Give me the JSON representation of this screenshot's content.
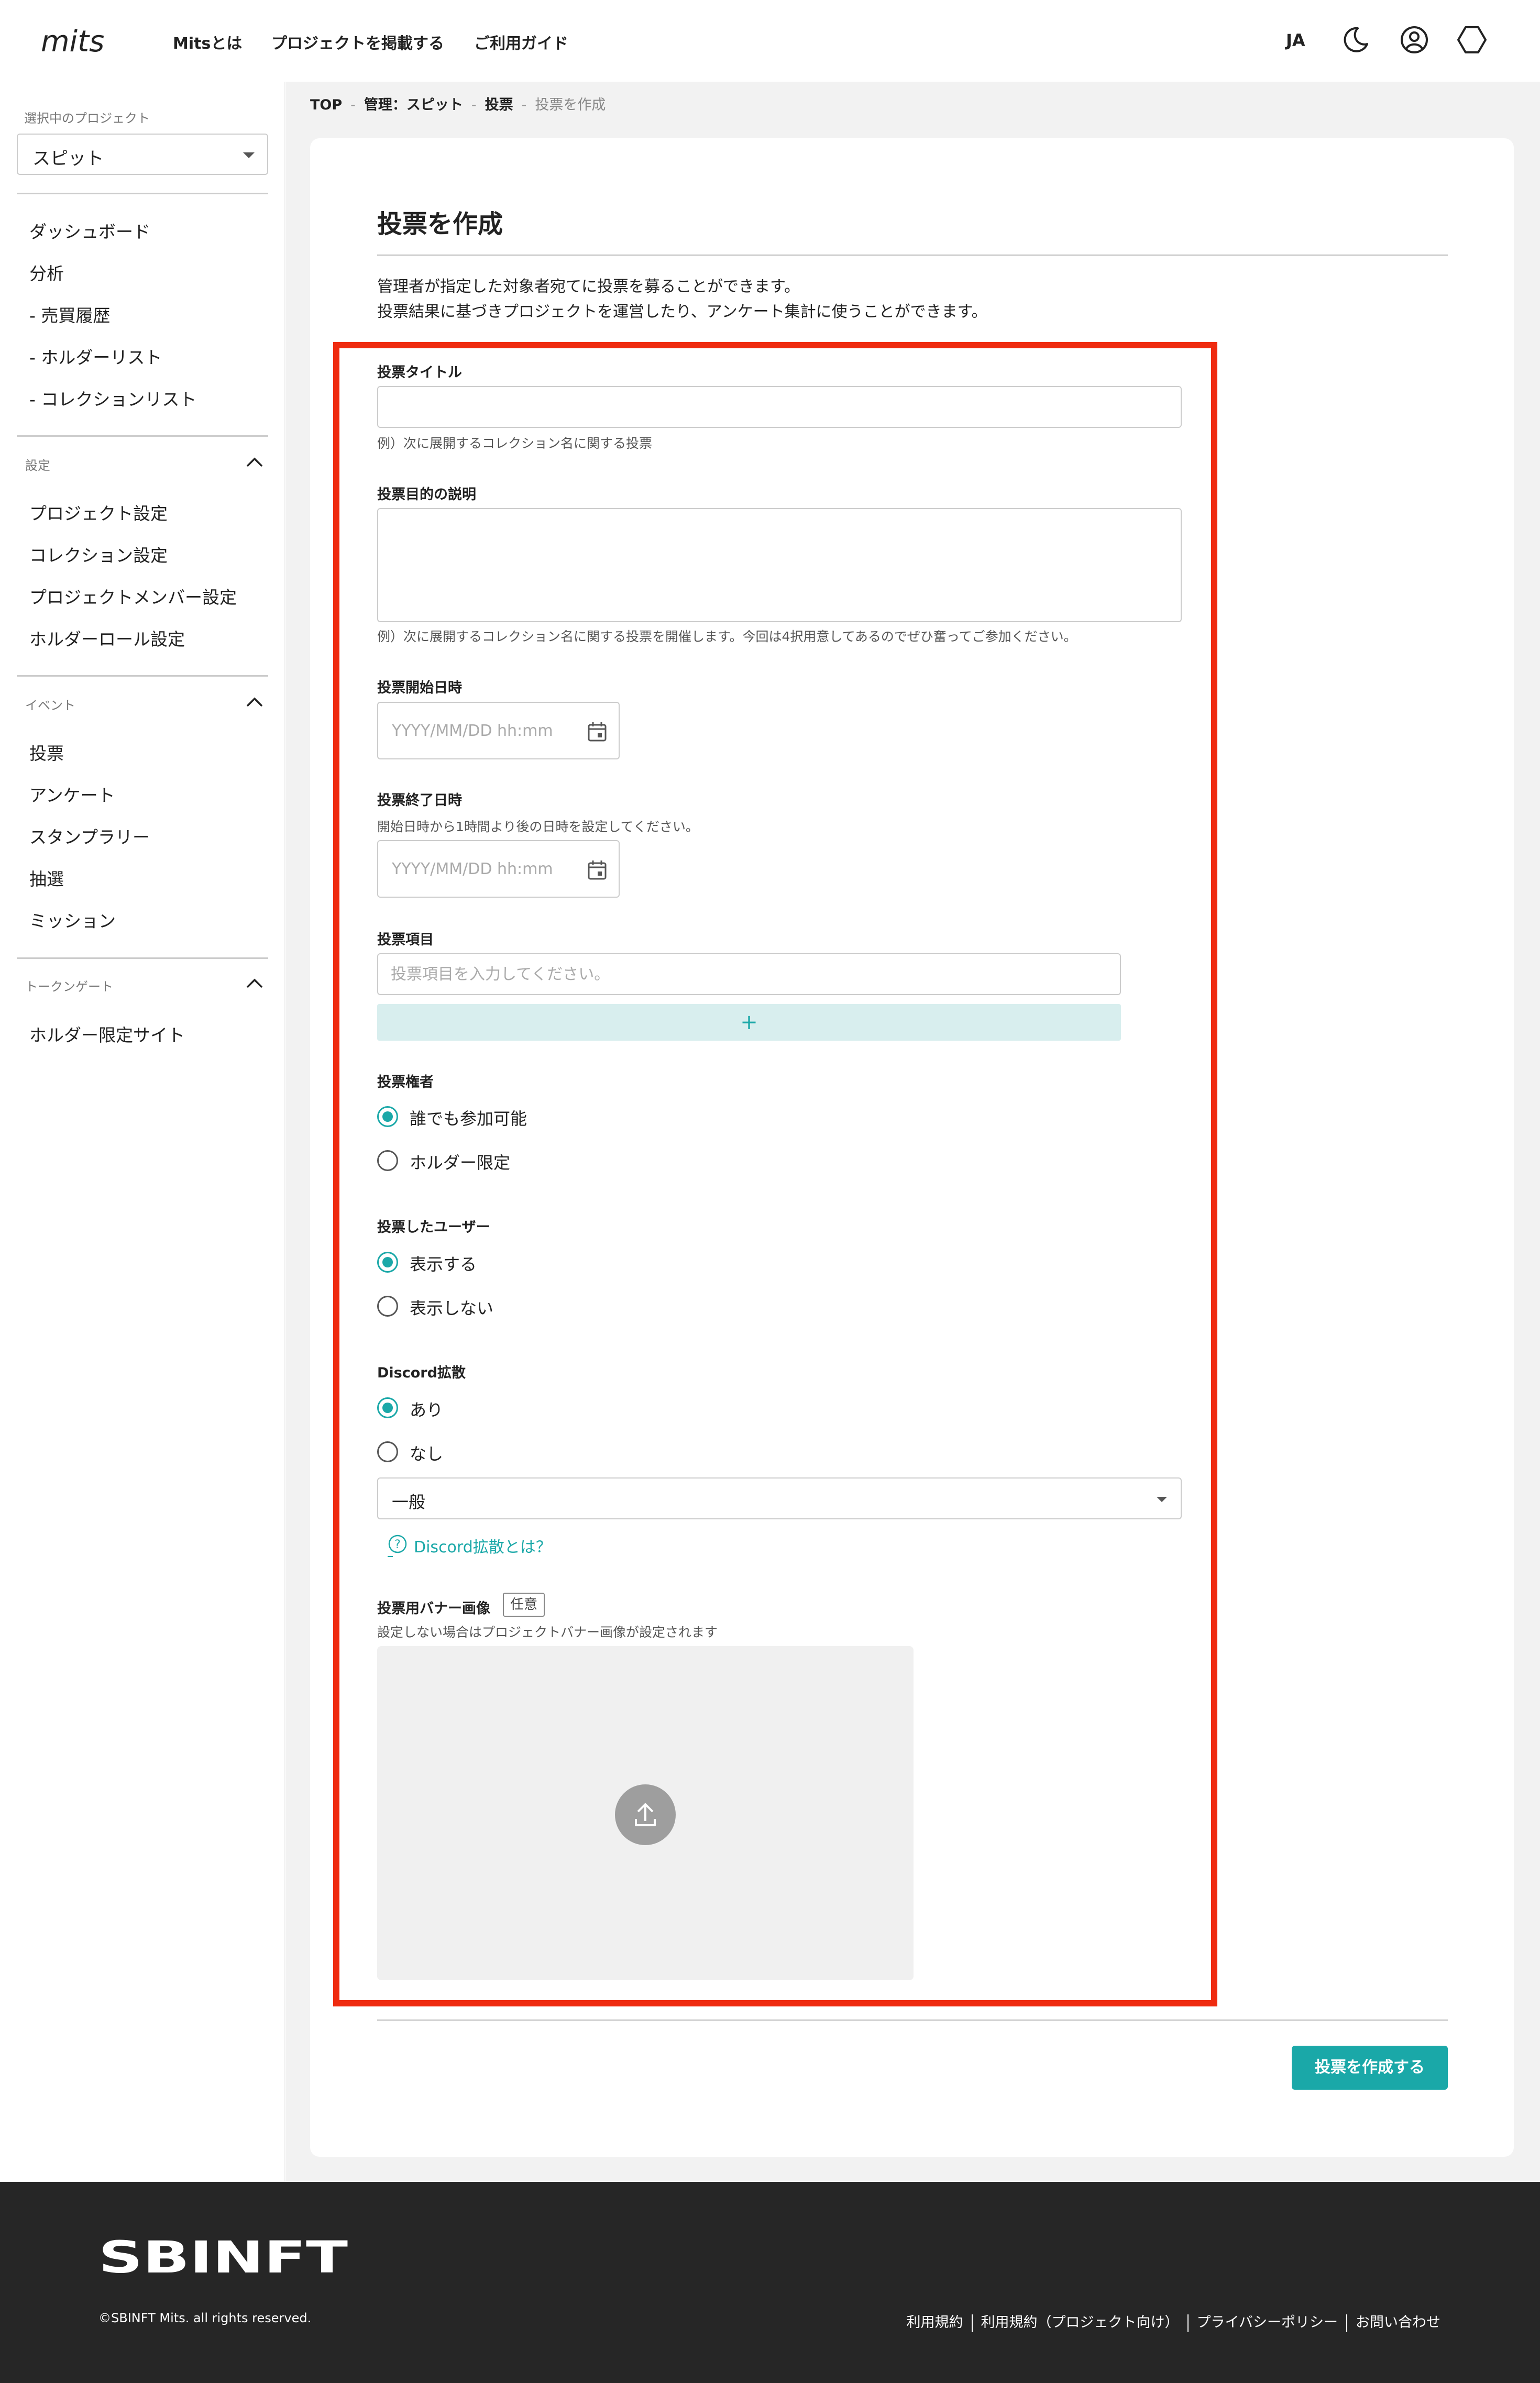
{
  "header": {
    "logo_text": "mits",
    "nav": [
      "Mitsとは",
      "プロジェクトを掲載する",
      "ご利用ガイド"
    ],
    "language": "JA"
  },
  "sidebar": {
    "project_caption": "選択中のプロジェクト",
    "project_selected": "スピット",
    "top_items": [
      "ダッシュボード",
      "分析",
      "- 売買履歴",
      "- ホルダーリスト",
      "- コレクションリスト"
    ],
    "sections": [
      {
        "title": "設定",
        "items": [
          "プロジェクト設定",
          "コレクション設定",
          "プロジェクトメンバー設定",
          "ホルダーロール設定"
        ]
      },
      {
        "title": "イベント",
        "items": [
          "投票",
          "アンケート",
          "スタンプラリー",
          "抽選",
          "ミッション"
        ]
      },
      {
        "title": "トークンゲート",
        "items": [
          "ホルダー限定サイト"
        ]
      }
    ]
  },
  "breadcrumb": {
    "top": "TOP",
    "project": "管理：スピット",
    "section": "投票",
    "current": "投票を作成",
    "separator": "-"
  },
  "page": {
    "title": "投票を作成",
    "description": [
      "管理者が指定した対象者宛てに投票を募ることができます。",
      "投票結果に基づきプロジェクトを運営したり、アンケート集計に使うことができます。"
    ]
  },
  "form": {
    "title_label": "投票タイトル",
    "title_value": "",
    "title_hint": "例）次に展開するコレクション名に関する投票",
    "purpose_label": "投票目的の説明",
    "purpose_value": "",
    "purpose_hint": "例）次に展開するコレクション名に関する投票を開催します。今回は4択用意してあるのでぜひ奮ってご参加ください。",
    "start_label": "投票開始日時",
    "start_placeholder": "YYYY/MM/DD hh:mm",
    "end_label": "投票終了日時",
    "end_hint": "開始日時から1時間より後の日時を設定してください。",
    "end_placeholder": "YYYY/MM/DD hh:mm",
    "items_label": "投票項目",
    "items_placeholder": "投票項目を入力してください。",
    "add_item": "+",
    "voter_label": "投票権者",
    "voter_options": [
      {
        "label": "誰でも参加可能",
        "selected": true
      },
      {
        "label": "ホルダー限定",
        "selected": false
      }
    ],
    "voted_users_label": "投票したユーザー",
    "voted_users_options": [
      {
        "label": "表示する",
        "selected": true
      },
      {
        "label": "表示しない",
        "selected": false
      }
    ],
    "discord_label": "Discord拡散",
    "discord_options": [
      {
        "label": "あり",
        "selected": true
      },
      {
        "label": "なし",
        "selected": false
      }
    ],
    "discord_channel": "一般",
    "discord_help": "Discord拡散とは？",
    "banner_label": "投票用バナー画像",
    "banner_badge": "任意",
    "banner_hint": "設定しない場合はプロジェクトバナー画像が設定されます",
    "upload_icon": "upload-icon"
  },
  "submit_label": "投票を作成する",
  "footer": {
    "brand": "SBINFT",
    "copyright": "©SBINFT Mits. all rights reserved.",
    "links": [
      "利用規約",
      "利用規約（プロジェクト向け）",
      "プライバシーポリシー",
      "お問い合わせ"
    ]
  },
  "colors": {
    "accent": "#1aa8a8",
    "highlight_border": "#ef2b10",
    "footer_bg": "#262626",
    "main_bg": "#f2f2f2"
  }
}
